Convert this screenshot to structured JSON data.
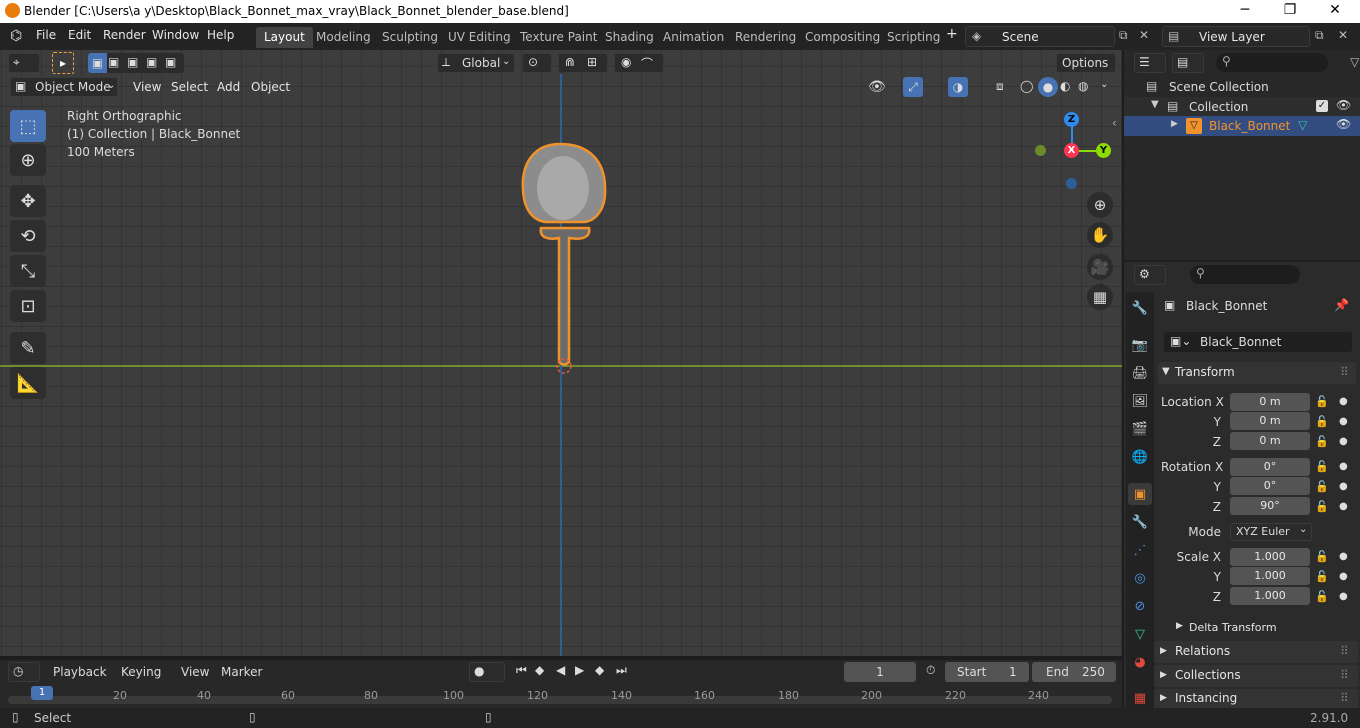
{
  "window": {
    "title": "Blender [C:\\Users\\a y\\Desktop\\Black_Bonnet_max_vray\\Black_Bonnet_blender_base.blend]",
    "minimize": "─",
    "maximize": "❐",
    "close": "✕"
  },
  "menu": [
    "File",
    "Edit",
    "Render",
    "Window",
    "Help"
  ],
  "workspaces": [
    {
      "label": "Layout",
      "active": true
    },
    {
      "label": "Modeling"
    },
    {
      "label": "Sculpting"
    },
    {
      "label": "UV Editing"
    },
    {
      "label": "Texture Paint"
    },
    {
      "label": "Shading"
    },
    {
      "label": "Animation"
    },
    {
      "label": "Rendering"
    },
    {
      "label": "Compositing"
    },
    {
      "label": "Scripting"
    }
  ],
  "add_workspace": "+",
  "scene": {
    "label": "Scene"
  },
  "view_layer": {
    "label": "View Layer"
  },
  "toolbar": {
    "orientation": "Global",
    "options": "Options"
  },
  "viewport_header": {
    "mode": "Object Mode",
    "menus": [
      "View",
      "Select",
      "Add",
      "Object"
    ]
  },
  "viewport": {
    "view_name": "Right Orthographic",
    "collection_info": "(1) Collection | Black_Bonnet",
    "scale": "100 Meters"
  },
  "gizmo": {
    "z": "Z",
    "x": "X",
    "y": "Y"
  },
  "outliner": {
    "root": "Scene Collection",
    "collection": "Collection",
    "object": "Black_Bonnet"
  },
  "properties": {
    "object_name": "Black_Bonnet",
    "data_name": "Black_Bonnet",
    "transform_header": "Transform",
    "location": {
      "label": "Location X",
      "y": "Y",
      "z": "Z",
      "x_val": "0 m",
      "y_val": "0 m",
      "z_val": "0 m"
    },
    "rotation": {
      "label": "Rotation X",
      "y": "Y",
      "z": "Z",
      "x_val": "0°",
      "y_val": "0°",
      "z_val": "90°"
    },
    "mode": {
      "label": "Mode",
      "value": "XYZ Euler"
    },
    "scale": {
      "label": "Scale X",
      "y": "Y",
      "z": "Z",
      "x_val": "1.000",
      "y_val": "1.000",
      "z_val": "1.000"
    },
    "sections": [
      "Delta Transform",
      "Relations",
      "Collections",
      "Instancing"
    ]
  },
  "timeline": {
    "menus": [
      "Playback",
      "Keying",
      "View",
      "Marker"
    ],
    "current_frame": "1",
    "start_label": "Start",
    "start": "1",
    "end_label": "End",
    "end": "250",
    "ticks": [
      "1",
      "20",
      "40",
      "60",
      "80",
      "100",
      "120",
      "140",
      "160",
      "180",
      "200",
      "220",
      "240"
    ]
  },
  "status": {
    "select": "Select",
    "version": "2.91.0"
  },
  "colors": {
    "accent": "#4772b3",
    "selection": "#f0932c",
    "x_axis": "#ff3352",
    "y_axis": "#8bdc00",
    "z_axis": "#2d8ceb"
  }
}
